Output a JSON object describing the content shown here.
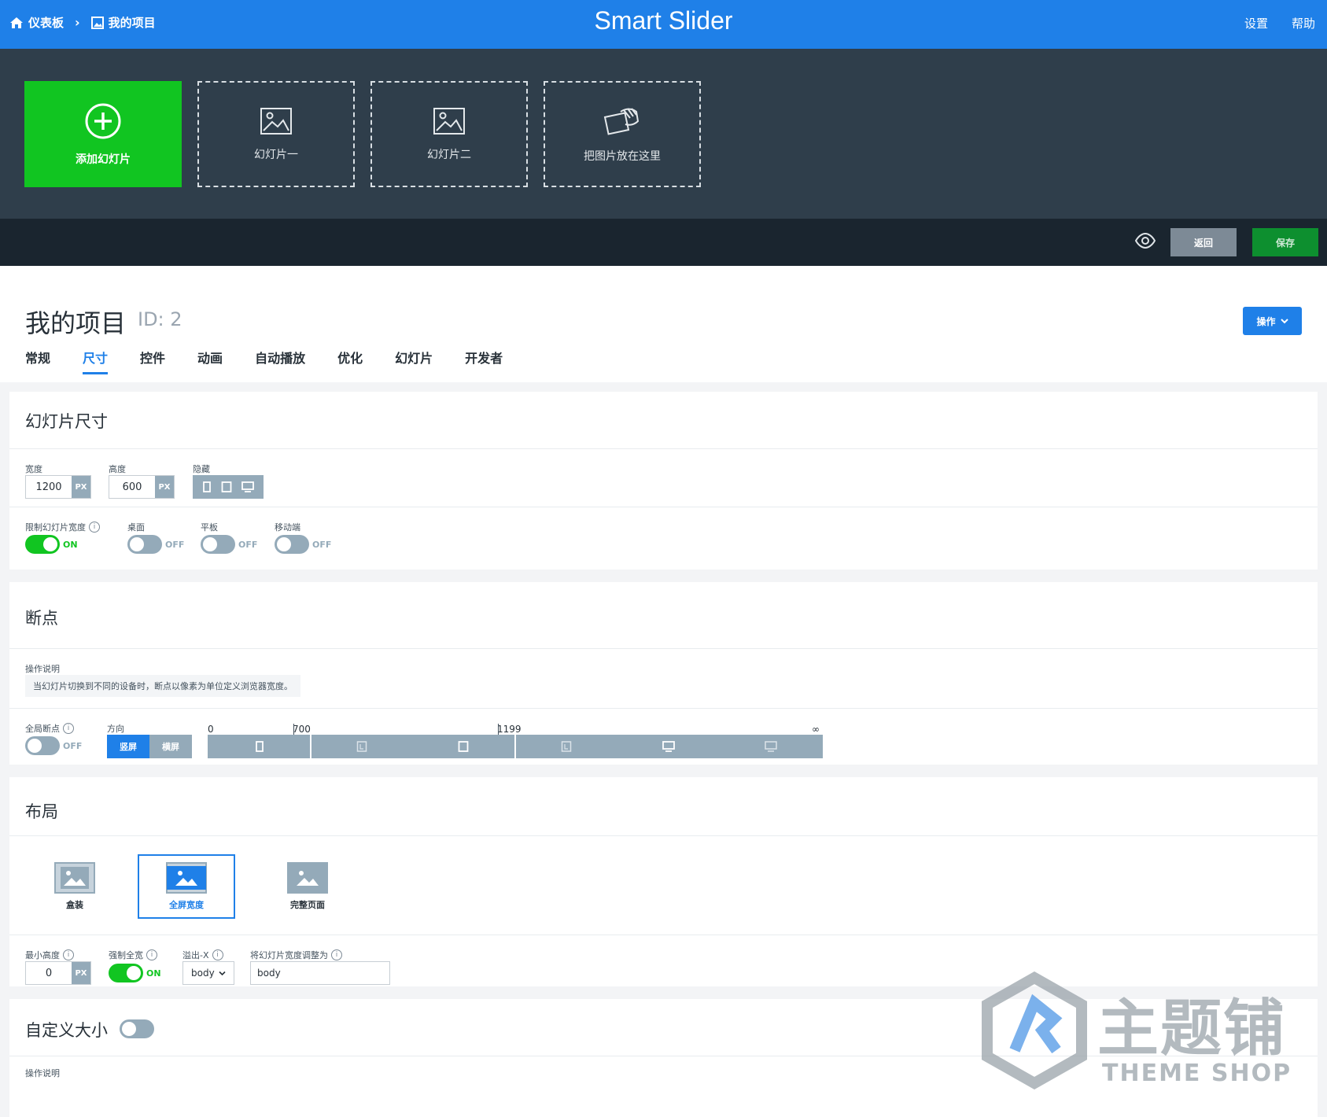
{
  "topbar": {
    "crumb_dashboard": "仪表板",
    "crumb_project": "我的项目",
    "brand": "Smart Slider",
    "settings": "设置",
    "help": "帮助"
  },
  "slides": {
    "add_label": "添加幻灯片",
    "items": [
      "幻灯片一",
      "幻灯片二",
      "把图片放在这里"
    ]
  },
  "actions": {
    "back": "返回",
    "save": "保存"
  },
  "header": {
    "title": "我的项目",
    "id": "ID: 2",
    "ops": "操作"
  },
  "tabs": [
    "常规",
    "尺寸",
    "控件",
    "动画",
    "自动播放",
    "优化",
    "幻灯片",
    "开发者"
  ],
  "active_tab": "尺寸",
  "size_panel": {
    "title": "幻灯片尺寸",
    "width_label": "宽度",
    "width_value": "1200",
    "height_label": "高度",
    "height_value": "600",
    "unit": "PX",
    "hide_label": "隐藏",
    "limit_label": "限制幻灯片宽度",
    "desktop_label": "桌面",
    "tablet_label": "平板",
    "mobile_label": "移动端",
    "on": "ON",
    "off": "OFF"
  },
  "breakpoints": {
    "title": "断点",
    "desc_label": "操作说明",
    "desc_text": "当幻灯片切换到不同的设备时，断点以像素为单位定义浏览器宽度。",
    "global_label": "全局断点",
    "off": "OFF",
    "direction_label": "方向",
    "portrait": "竖屏",
    "landscape": "横屏",
    "tick_0": "0",
    "tick_700": "700",
    "tick_1199": "1199",
    "tick_inf": "∞"
  },
  "layout": {
    "title": "布局",
    "boxed": "盒装",
    "fullwidth": "全屏宽度",
    "fullpage": "完整页面",
    "min_height_label": "最小高度",
    "min_height_value": "0",
    "unit": "PX",
    "force_full_label": "强制全宽",
    "on": "ON",
    "overflow_label": "溢出-X",
    "overflow_value": "body",
    "adjust_label": "将幻灯片宽度调整为",
    "adjust_value": "body"
  },
  "custom_size": {
    "title": "自定义大小",
    "desc_label": "操作说明"
  },
  "watermark": {
    "cn": "主题铺",
    "en": "THEME SHOP"
  },
  "colors": {
    "primary_blue": "#1f80e8",
    "green": "#11c521",
    "dark_strip": "#2f3e4b",
    "action_bar": "#1a252f",
    "muted": "#94aab9"
  }
}
